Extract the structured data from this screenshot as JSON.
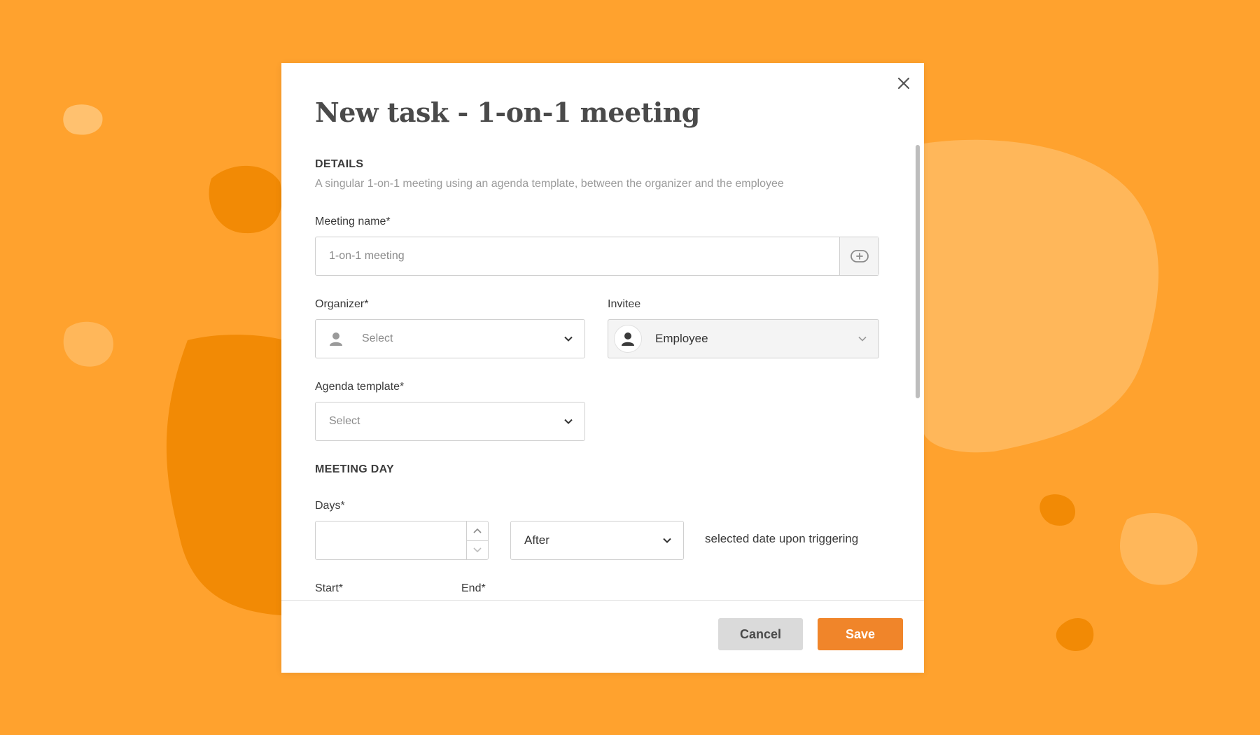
{
  "modal": {
    "title": "New task - 1-on-1 meeting",
    "close_icon": "close-icon",
    "details": {
      "heading": "DETAILS",
      "description": "A singular 1-on-1 meeting using an agenda template, between the organizer and the employee"
    },
    "meeting_name": {
      "label": "Meeting name*",
      "placeholder": "1-on-1 meeting",
      "addon_icon": "add-variable-icon"
    },
    "organizer": {
      "label": "Organizer*",
      "placeholder": "Select",
      "icon": "person-icon"
    },
    "invitee": {
      "label": "Invitee",
      "value": "Employee",
      "icon": "person-icon"
    },
    "agenda_template": {
      "label": "Agenda template*",
      "placeholder": "Select"
    },
    "meeting_day": {
      "heading": "MEETING DAY",
      "days_label": "Days*",
      "days_value": "",
      "relation_value": "After",
      "suffix_text": "selected date upon triggering",
      "start_label": "Start*",
      "end_label": "End*"
    },
    "footer": {
      "cancel_label": "Cancel",
      "save_label": "Save"
    }
  },
  "colors": {
    "background": "#FFA22E",
    "accent": "#F0852A",
    "blob_dark": "#F28A05",
    "blob_light": "#FFB75A"
  }
}
